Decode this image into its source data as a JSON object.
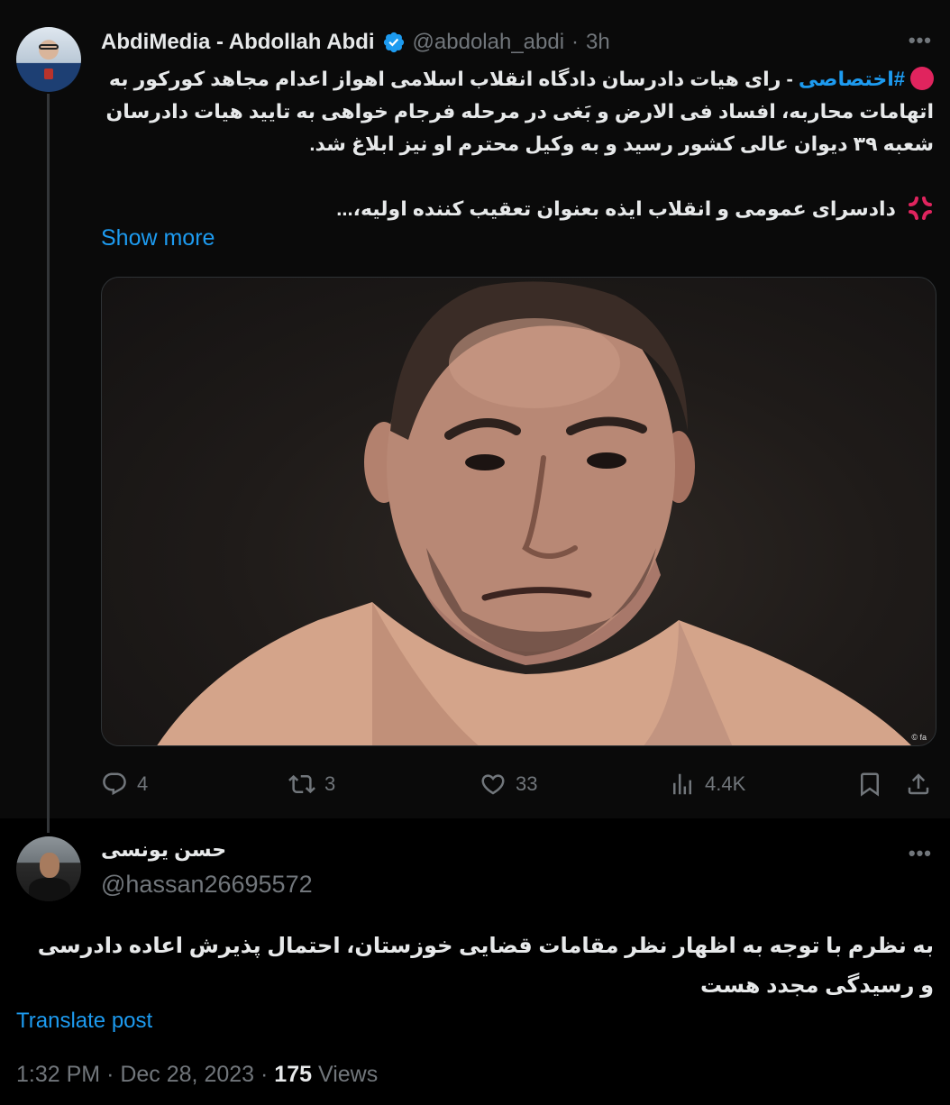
{
  "parent_tweet": {
    "display_name": "AbdiMedia - Abdollah Abdi",
    "handle": "@abdolah_abdi",
    "separator": "·",
    "time": "3h",
    "more": "•••",
    "hashtag": "#اختصاصی",
    "paragraph1": "- رای هیات دادرسان دادگاه انقلاب اسلامی اهواز اعدام مجاهد کورکور به اتهامات محاربه، افساد فی الارض و بَغی در مرحله فرجام خواهی به تایید هیات دادرسان شعبه ۳۹ دیوان عالی کشور رسید و به وکیل محترم او نیز ابلاغ شد.",
    "paragraph2": "دادسرای عمومی و انقلاب ایذه بعنوان تعقیب کننده اولیه،...",
    "show_more": "Show more",
    "media_credit": "© fa",
    "actions": {
      "replies": "4",
      "retweets": "3",
      "likes": "33",
      "views": "4.4K"
    }
  },
  "reply_tweet": {
    "display_name": "حسن یونسی",
    "handle": "@hassan26695572",
    "more": "•••",
    "text": "به نظرم با توجه به اظهار نظر مقامات قضایی خوزستان، احتمال پذیرش اعاده دادرسی و رسیدگی مجدد هست",
    "translate": "Translate post",
    "time": "1:32 PM",
    "separator": "·",
    "date": "Dec 28, 2023",
    "views_count": "175",
    "views_label": "Views"
  },
  "colors": {
    "background": "#000000",
    "link": "#1d9bf0",
    "secondary_text": "#71767b",
    "primary_text": "#e7e9ea"
  }
}
